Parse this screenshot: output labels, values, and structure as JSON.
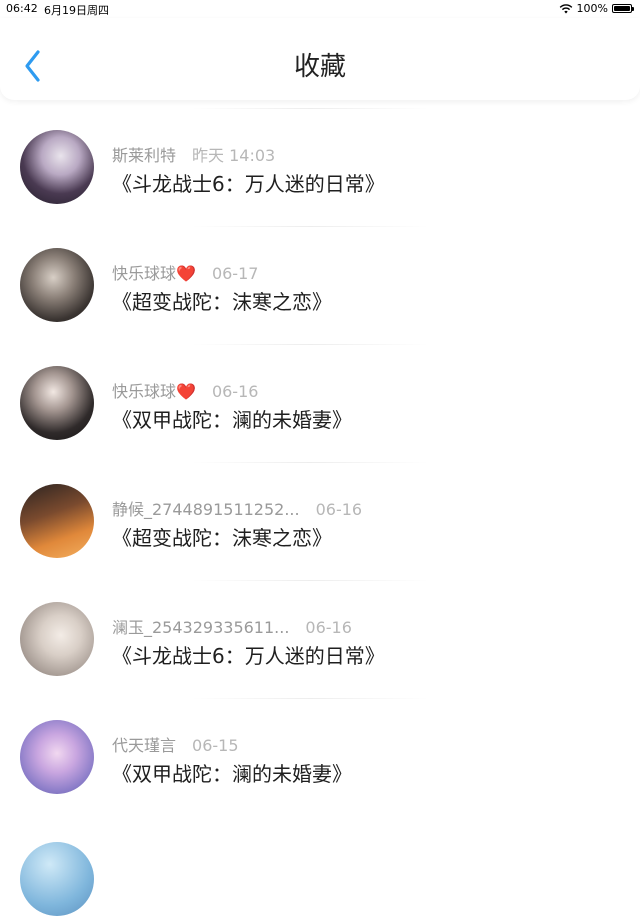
{
  "status": {
    "time": "06:42",
    "date": "6月19日周四",
    "battery": "100%",
    "battery_level": 1.0
  },
  "nav": {
    "title": "收藏",
    "back_icon": "chevron-left-icon",
    "accent": "#2e9bf0"
  },
  "items": [
    {
      "user": "斯莱利特",
      "heart": "",
      "time": "昨天 14:03",
      "comic": "《斗龙战士6：万人迷的日常》"
    },
    {
      "user": "快乐球球",
      "heart": "❤️",
      "time": "06-17",
      "comic": "《超变战陀：沫寒之恋》"
    },
    {
      "user": "快乐球球",
      "heart": "❤️",
      "time": "06-16",
      "comic": "《双甲战陀：澜的未婚妻》"
    },
    {
      "user": "静候_2744891511252...",
      "heart": "",
      "time": "06-16",
      "comic": "《超变战陀：沫寒之恋》"
    },
    {
      "user": "澜玉_254329335611...",
      "heart": "",
      "time": "06-16",
      "comic": "《斗龙战士6：万人迷的日常》"
    },
    {
      "user": "代天瑾言",
      "heart": "",
      "time": "06-15",
      "comic": "《双甲战陀：澜的未婚妻》"
    }
  ]
}
